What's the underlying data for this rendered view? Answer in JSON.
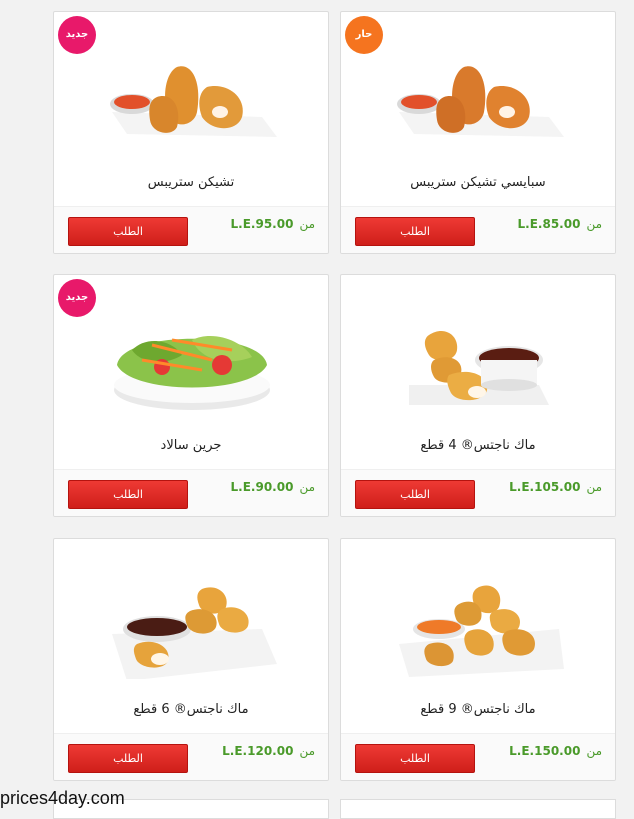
{
  "products": [
    {
      "name": "سبايسي تشيكن ستريبس",
      "price_prefix": "من",
      "price": "L.E.85.00",
      "button": "الطلب",
      "badge": "حار",
      "badge_type": "hot",
      "image": "chicken-strips"
    },
    {
      "name": "تشيكن ستريبس",
      "price_prefix": "من",
      "price": "L.E.95.00",
      "button": "الطلب",
      "badge": "جديد",
      "badge_type": "new",
      "image": "chicken-strips"
    },
    {
      "name": "ماك ناجتس® 4 قطع",
      "price_prefix": "من",
      "price": "L.E.105.00",
      "button": "الطلب",
      "badge": "",
      "badge_type": "",
      "image": "nuggets-4"
    },
    {
      "name": "جرين سالاد",
      "price_prefix": "من",
      "price": "L.E.90.00",
      "button": "الطلب",
      "badge": "جديد",
      "badge_type": "new",
      "image": "salad"
    },
    {
      "name": "ماك ناجتس® 9 قطع",
      "price_prefix": "من",
      "price": "L.E.150.00",
      "button": "الطلب",
      "badge": "",
      "badge_type": "",
      "image": "nuggets-9"
    },
    {
      "name": "ماك ناجتس® 6 قطع",
      "price_prefix": "من",
      "price": "L.E.120.00",
      "button": "الطلب",
      "badge": "",
      "badge_type": "",
      "image": "nuggets-6"
    }
  ],
  "watermark": "prices4day.com",
  "colors": {
    "button": "#e0271f",
    "price": "#4a9a2a",
    "badge_new": "#e8196a",
    "badge_hot": "#f5741f"
  }
}
